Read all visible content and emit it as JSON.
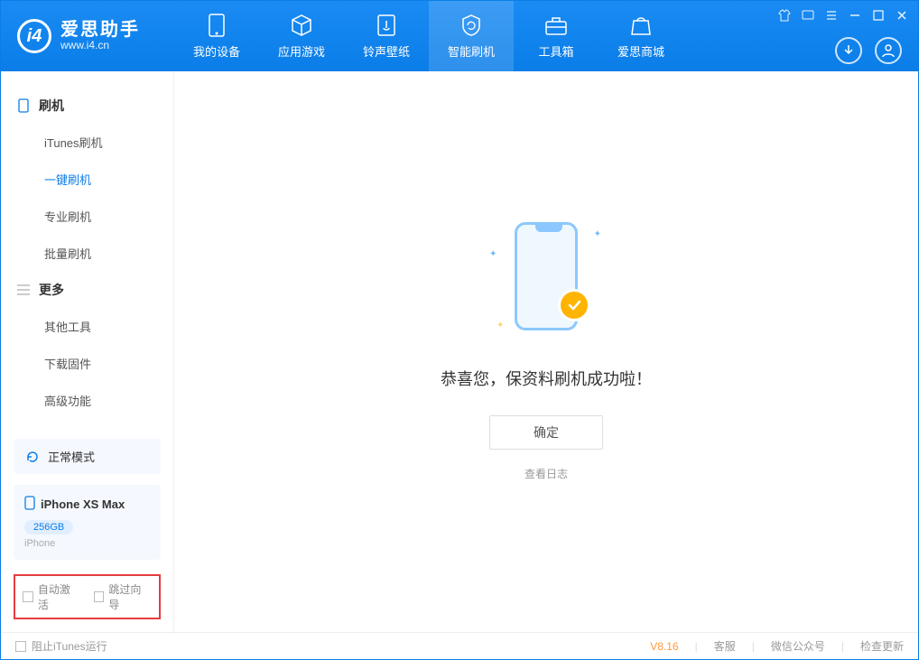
{
  "app": {
    "title": "爱思助手",
    "subtitle": "www.i4.cn"
  },
  "nav": [
    {
      "label": "我的设备"
    },
    {
      "label": "应用游戏"
    },
    {
      "label": "铃声壁纸"
    },
    {
      "label": "智能刷机"
    },
    {
      "label": "工具箱"
    },
    {
      "label": "爱思商城"
    }
  ],
  "sidebar": {
    "group1": {
      "title": "刷机"
    },
    "items1": [
      {
        "label": "iTunes刷机"
      },
      {
        "label": "一键刷机"
      },
      {
        "label": "专业刷机"
      },
      {
        "label": "批量刷机"
      }
    ],
    "group2": {
      "title": "更多"
    },
    "items2": [
      {
        "label": "其他工具"
      },
      {
        "label": "下载固件"
      },
      {
        "label": "高级功能"
      }
    ],
    "mode_card": "正常模式",
    "device": {
      "name": "iPhone XS Max",
      "storage": "256GB",
      "type": "iPhone"
    },
    "checks": {
      "auto_activate": "自动激活",
      "skip_guide": "跳过向导"
    }
  },
  "main": {
    "success_text": "恭喜您，保资料刷机成功啦！",
    "ok_button": "确定",
    "view_log": "查看日志"
  },
  "footer": {
    "block_itunes": "阻止iTunes运行",
    "version": "V8.16",
    "links": {
      "service": "客服",
      "wechat": "微信公众号",
      "update": "检查更新"
    }
  }
}
